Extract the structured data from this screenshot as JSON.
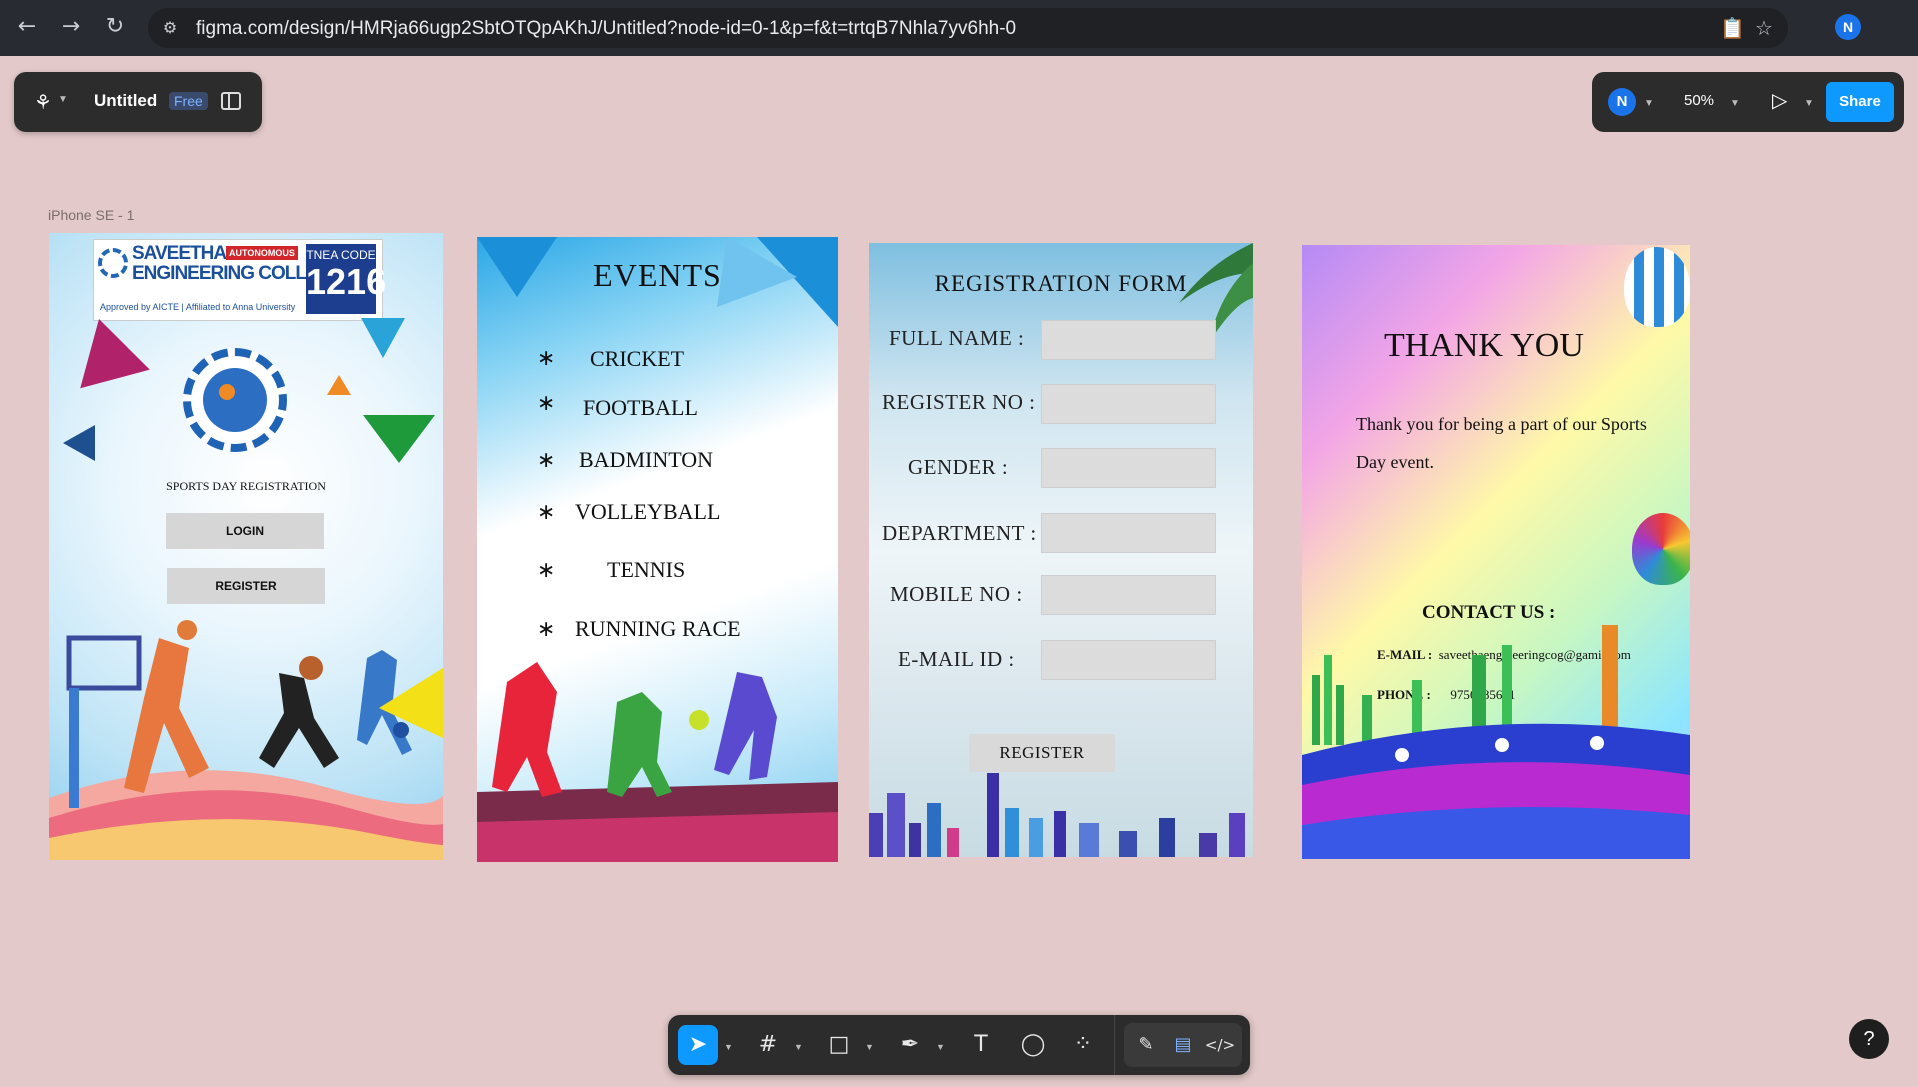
{
  "browser": {
    "url": "figma.com/design/HMRja66ugp2SbtOTQpAKhJ/Untitled?node-id=0-1&p=f&t=trtqB7Nhla7yv6hh-0",
    "back_icon": "←",
    "forward_icon": "→",
    "reload_icon": "↻",
    "site_settings_icon": "⚙",
    "clipboard_icon": "📋",
    "bookmark_icon": "☆",
    "profile_initial": "N"
  },
  "figma": {
    "file_title": "Untitled",
    "plan_badge": "Free",
    "user_initial": "N",
    "zoom": "50%",
    "share_label": "Share",
    "frame_label": "iPhone SE - 1",
    "accent_color": "#0d99ff"
  },
  "frame1": {
    "college_name_line1": "SAVEETHA",
    "college_name_line2": "ENGINEERING COLLEGE",
    "autonomous_badge": "AUTONOMOUS",
    "approved_text": "Approved by AICTE | Affiliated to Anna University",
    "tnea_label": "TNEA CODE",
    "tnea_code": "1216",
    "title": "SPORTS DAY REGISTRATION",
    "login_label": "LOGIN",
    "register_label": "REGISTER"
  },
  "frame2": {
    "title": "EVENTS",
    "events": [
      "CRICKET",
      "FOOTBALL",
      "BADMINTON",
      "VOLLEYBALL",
      "TENNIS",
      "RUNNING RACE"
    ],
    "bullet": "∗"
  },
  "frame3": {
    "title": "REGISTRATION FORM",
    "fields": [
      "FULL NAME :",
      "REGISTER NO :",
      "GENDER :",
      "DEPARTMENT :",
      "MOBILE NO :",
      "E-MAIL ID :"
    ],
    "register_label": "REGISTER"
  },
  "frame4": {
    "title": "THANK YOU",
    "message": "Thank you for being a part of our Sports Day event.",
    "contact_heading": "CONTACT US :",
    "email_label": "E-MAIL :",
    "email_value": "saveethaengineeringcog@gamil.com",
    "phone_label": "PHONE :",
    "phone_value": "9756885641"
  },
  "toolbar": {
    "tools": [
      {
        "name": "move-tool",
        "icon": "➤"
      },
      {
        "name": "frame-tool",
        "icon": "#"
      },
      {
        "name": "shape-tool",
        "icon": "□"
      },
      {
        "name": "pen-tool",
        "icon": "✒"
      },
      {
        "name": "text-tool",
        "icon": "T"
      },
      {
        "name": "comment-tool",
        "icon": "◯"
      },
      {
        "name": "actions-tool",
        "icon": "⁘"
      }
    ],
    "draw_mode_icon": "✎",
    "design_mode_icon": "▤",
    "dev_mode_icon": "</>"
  },
  "help_label": "?"
}
